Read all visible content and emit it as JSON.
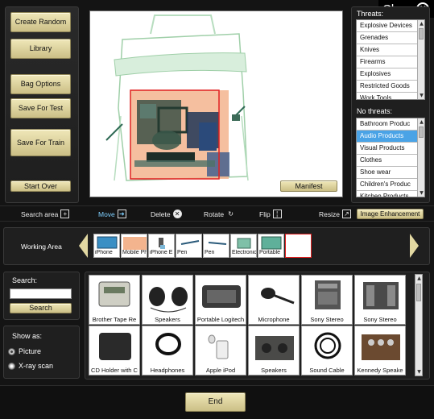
{
  "window": {
    "close_label": "Close"
  },
  "left_buttons": {
    "create_random": "Create Random",
    "library": "Library",
    "bag_options": "Bag Options",
    "save_for_test": "Save For Test",
    "save_for_train": "Save For Train",
    "start_over": "Start Over"
  },
  "viewer": {
    "manifest_label": "Manifest"
  },
  "threats": {
    "title": "Threats:",
    "items": [
      "Explosive Devices",
      "Grenades",
      "Knives",
      "Firearms",
      "Explosives",
      "Restricted Goods",
      "Work Tools"
    ]
  },
  "no_threats": {
    "title": "No threats:",
    "items": [
      "Bathroom Produc",
      "Audio Products",
      "Visual Products",
      "Clothes",
      "Shoe wear",
      "Children's Produc",
      "Kitchen Products"
    ],
    "selected": "Audio Products"
  },
  "toolbar": {
    "search_area": "Search area",
    "move": "Move",
    "delete": "Delete",
    "rotate": "Rotate",
    "flip": "Flip",
    "resize": "Resize",
    "image_enhancement": "Image Enhancement"
  },
  "working_area": {
    "label": "Working Area",
    "items": [
      "iPhone",
      "Mobile Ph",
      "iPhone E",
      "Pen",
      "Pen",
      "Electronic",
      "Portable",
      ""
    ]
  },
  "search": {
    "label": "Search:",
    "value": "",
    "button": "Search"
  },
  "show_as": {
    "label": "Show as:",
    "options": [
      "Picture",
      "X-ray scan"
    ],
    "selected": "Picture"
  },
  "catalog": {
    "items": [
      "Brother Tape Re",
      "Speakers",
      "Portable Logitech",
      "Microphone",
      "Sony Stereo",
      "Sony Stereo",
      "CD Holder with C",
      "Headphones",
      "Apple iPod",
      "Speakers",
      "Sound Cable",
      "Kennedy Speake"
    ]
  },
  "footer": {
    "end_label": "End"
  },
  "colors": {
    "gold": "#e2d8a2",
    "selection": "#4aa3e6",
    "threat_box": "#e02020"
  }
}
